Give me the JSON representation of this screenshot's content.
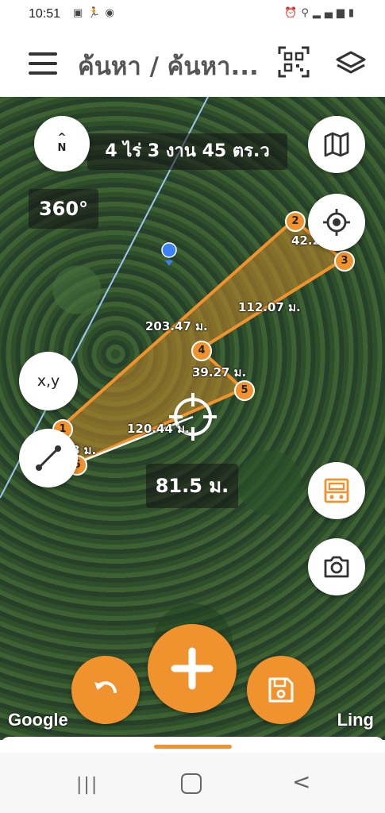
{
  "status_bar": {
    "time": "10:51",
    "left_icons": [
      "gallery-icon",
      "running-icon",
      "messenger-icon"
    ],
    "right_icons": [
      "alarm-icon",
      "location-icon",
      "data-icon",
      "signal-icon",
      "battery-icon"
    ]
  },
  "app_bar": {
    "title": "ค้นหา / ค้นหา...",
    "menu_icon": "hamburger-menu-icon",
    "qr_icon": "qr-scan-icon",
    "layers_icon": "layers-icon"
  },
  "map": {
    "area_text": "4 ไร่ 3 งาน 45 ตร.ว",
    "bearing_text": "360°",
    "compass": {
      "arrow": "^",
      "letter": "N"
    },
    "xy_label": "x,y",
    "current_distance": "81.5 ม.",
    "vertices": [
      "1",
      "2",
      "3",
      "4",
      "5",
      "6"
    ],
    "segment_labels": [
      "203.47 ม.",
      "42.2",
      "112.07 ม.",
      "39.27 ม.",
      "120.44 ม.",
      "8 ม."
    ],
    "attribution_left": "Google",
    "attribution_right": "Ling"
  },
  "colors": {
    "accent": "#f0922e",
    "polygon_fill": "#c88a2a",
    "road_line": "#9ec7f2"
  },
  "nav_bar": {
    "recent": "|||",
    "back": "<"
  }
}
